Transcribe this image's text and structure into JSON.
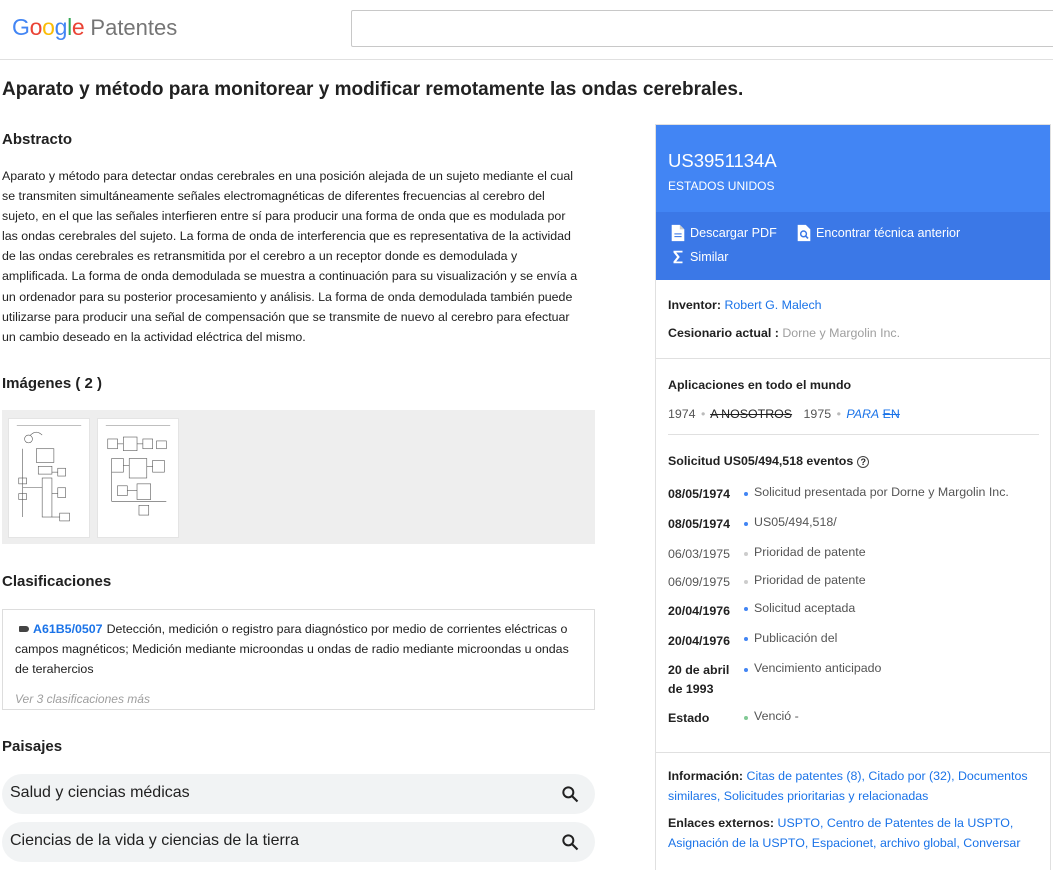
{
  "header": {
    "logo_letters": [
      "G",
      "o",
      "o",
      "g",
      "l",
      "e"
    ],
    "product": "Patentes",
    "search": {
      "value": "",
      "placeholder": ""
    }
  },
  "title": "Aparato y método para monitorear y modificar remotamente las ondas cerebrales.",
  "abstract": {
    "heading": "Abstracto",
    "text": "Aparato y método para detectar ondas cerebrales en una posición alejada de un sujeto mediante el cual se transmiten simultáneamente señales electromagnéticas de diferentes frecuencias al cerebro del sujeto, en el que las señales interfieren entre sí para producir una forma de onda que es modulada por las ondas cerebrales del sujeto. La forma de onda de interferencia que es representativa de la actividad de las ondas cerebrales es retransmitida por el cerebro a un receptor donde es demodulada y amplificada. La forma de onda demodulada se muestra a continuación para su visualización y se envía a un ordenador para su posterior procesamiento y análisis. La forma de onda demodulada también puede utilizarse para producir una señal de compensación que se transmite de nuevo al cerebro para efectuar un cambio deseado en la actividad eléctrica del mismo."
  },
  "images": {
    "heading": "Imágenes ( 2 )"
  },
  "classifications": {
    "heading": "Clasificaciones",
    "code": "A61B5/0507",
    "description": "Detección, medición o registro para diagnóstico por medio de corrientes eléctricas o campos magnéticos; Medición mediante microondas u ondas de radio mediante microondas u ondas de terahercios",
    "more": "Ver 3 clasificaciones más"
  },
  "landscapes": {
    "heading": "Paisajes",
    "items": [
      "Salud y ciencias médicas",
      "Ciencias de la vida y ciencias de la tierra"
    ]
  },
  "panel": {
    "number": "US3951134A",
    "country": "ESTADOS UNIDOS",
    "actions": {
      "pdf": "Descargar PDF",
      "prior_art": "Encontrar técnica anterior",
      "similar": "Similar"
    },
    "inventor_label": "Inventor:",
    "inventor": "Robert G. Malech",
    "assignee_label": "Cesionario actual :",
    "assignee": "Dorne y Margolin Inc.",
    "worldwide_heading": "Aplicaciones en todo el mundo",
    "worldwide": {
      "year1": "1974",
      "dot": "•",
      "country1": "A NOSOTROS",
      "year2": "1975",
      "country2a": "PARA",
      "country2b": "EN"
    },
    "events_heading": "Solicitud US05/494,518 eventos",
    "events": [
      {
        "date": "08/05/1974",
        "text": "Solicitud presentada por Dorne y Margolin Inc."
      },
      {
        "date": "08/05/1974",
        "text": "US05/494,518/"
      },
      {
        "date": "06/03/1975",
        "text": "Prioridad de patente"
      },
      {
        "date": "06/09/1975",
        "text": "Prioridad de patente"
      },
      {
        "date": "20/04/1976",
        "text": "Solicitud aceptada"
      },
      {
        "date": "20/04/1976",
        "text": "Publicación del"
      },
      {
        "date_l1": "20 de abril",
        "date_l2": "de 1993",
        "text": "Vencimiento anticipado"
      }
    ],
    "status_label": "Estado",
    "status": "Venció -",
    "info_label": "Información:",
    "info_links": [
      "Citas de patentes (8),",
      "Citado por (32),",
      "Documentos similares,",
      "Solicitudes prioritarias y relacionadas"
    ],
    "external_label": "Enlaces externos:",
    "external_links": [
      "USPTO,",
      "Centro de Patentes de la USPTO,",
      "Asignación de la USPTO,",
      "Espacionet,",
      "archivo global,",
      "Conversar"
    ]
  }
}
